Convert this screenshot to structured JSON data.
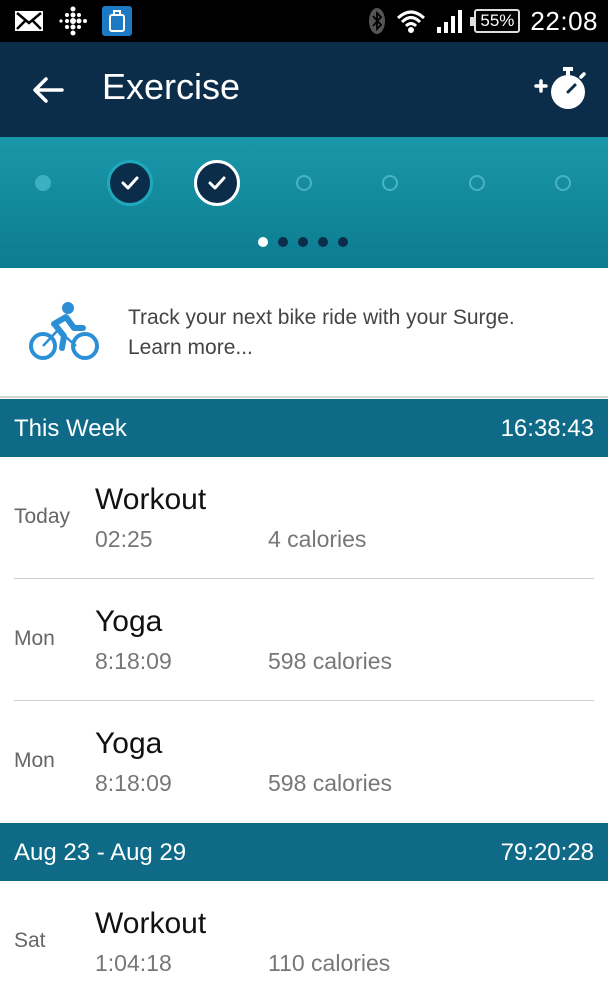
{
  "status_bar": {
    "icons_left": [
      "mail-icon",
      "fitbit-icon",
      "app-icon"
    ],
    "icons_right": [
      "bluetooth-icon",
      "wifi-icon",
      "signal-icon",
      "battery-icon"
    ],
    "battery": "55%",
    "time": "22:08"
  },
  "app_bar": {
    "title": "Exercise",
    "back_icon": "arrow-left-icon",
    "action_icon": "add-stopwatch-icon"
  },
  "week_dots": {
    "days": [
      "dot",
      "check",
      "check-selected",
      "ring",
      "ring",
      "ring",
      "ring"
    ],
    "pages": 5,
    "active_page": 1
  },
  "promo": {
    "icon": "bike-icon",
    "line1": "Track your next bike ride with your Surge.",
    "line2": "Learn more..."
  },
  "sections": [
    {
      "label": "This Week",
      "total": "16:38:43",
      "entries": [
        {
          "day": "Today",
          "name": "Workout",
          "duration": "02:25",
          "calories": "4 calories"
        },
        {
          "day": "Mon",
          "name": "Yoga",
          "duration": "8:18:09",
          "calories": "598 calories"
        },
        {
          "day": "Mon",
          "name": "Yoga",
          "duration": "8:18:09",
          "calories": "598 calories"
        }
      ]
    },
    {
      "label": "Aug 23 - Aug 29",
      "total": "79:20:28",
      "entries": [
        {
          "day": "Sat",
          "name": "Workout",
          "duration": "1:04:18",
          "calories": "110 calories"
        }
      ]
    }
  ],
  "colors": {
    "app_bar": "#0b2d4a",
    "band": "#1a97a8",
    "section_header": "#0e6a87",
    "promo_icon": "#2b8fd6"
  }
}
